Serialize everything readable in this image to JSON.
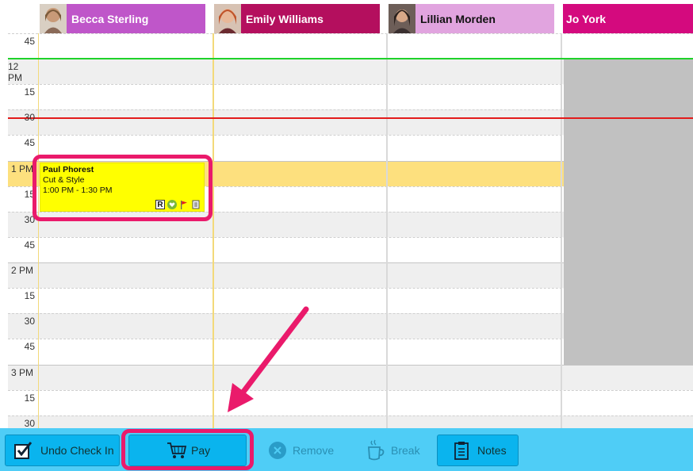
{
  "staff": [
    {
      "name": "Becca Sterling"
    },
    {
      "name": "Emily Williams"
    },
    {
      "name": "Lillian Morden"
    },
    {
      "name": "Jo York"
    }
  ],
  "time_labels": [
    "45",
    "12 PM",
    "15",
    "30",
    "45",
    "1 PM",
    "15",
    "30",
    "45",
    "2 PM",
    "15",
    "30",
    "45",
    "3 PM",
    "15",
    "30"
  ],
  "appointment": {
    "client": "Paul Phorest",
    "service": "Cut & Style",
    "time": "1:00 PM - 1:30 PM",
    "badge": "R"
  },
  "toolbar": {
    "undo_check_in": "Undo Check In",
    "pay": "Pay",
    "remove": "Remove",
    "break": "Break",
    "notes": "Notes"
  },
  "colors": {
    "accent": "#4fcdf6",
    "highlight": "#ea1a6b",
    "appointment": "#ffff00"
  }
}
